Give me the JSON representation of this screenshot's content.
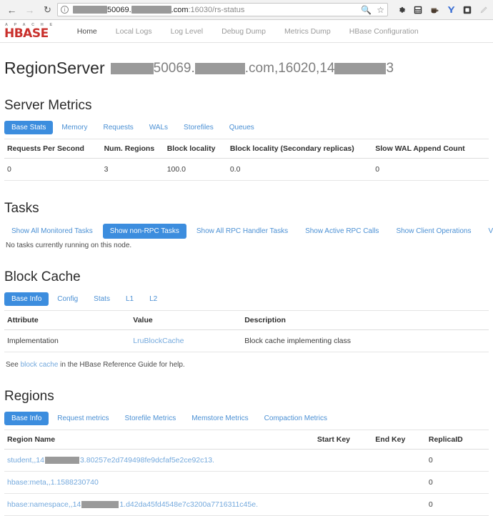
{
  "browser": {
    "back_icon": "back-arrow-icon",
    "forward_icon": "forward-arrow-icon",
    "reload_icon": "reload-icon",
    "info_icon": "info-icon",
    "url": {
      "redacted_1_width": 48,
      "visible_1": "50069.",
      "redacted_2_width": 56,
      "visible_2": ".com",
      "dim_suffix": ":16030/rs-status"
    },
    "search_icon": "search-icon",
    "star_icon": "bookmark-star-icon",
    "extensions": [
      "gear-icon",
      "calculator-icon",
      "coffee-icon",
      "y-letter-icon",
      "square-icon",
      "pen-icon"
    ]
  },
  "brand": {
    "apache": "A P A C H E",
    "hbase": "HBASE"
  },
  "nav": {
    "items": [
      {
        "label": "Home",
        "active": true
      },
      {
        "label": "Local Logs",
        "active": false
      },
      {
        "label": "Log Level",
        "active": false
      },
      {
        "label": "Debug Dump",
        "active": false
      },
      {
        "label": "Metrics Dump",
        "active": false
      },
      {
        "label": "HBase Configuration",
        "active": false
      }
    ]
  },
  "page_title": {
    "prefix": "RegionServer",
    "redacted_1_width": 60,
    "part_1": "50069.",
    "redacted_2_width": 70,
    "part_2": ".com,16020,14",
    "redacted_3_width": 72,
    "part_3": "3"
  },
  "server_metrics": {
    "heading": "Server Metrics",
    "tabs": [
      {
        "label": "Base Stats",
        "active": true
      },
      {
        "label": "Memory",
        "active": false
      },
      {
        "label": "Requests",
        "active": false
      },
      {
        "label": "WALs",
        "active": false
      },
      {
        "label": "Storefiles",
        "active": false
      },
      {
        "label": "Queues",
        "active": false
      }
    ],
    "columns": [
      "Requests Per Second",
      "Num. Regions",
      "Block locality",
      "Block locality (Secondary replicas)",
      "Slow WAL Append Count"
    ],
    "row": [
      "0",
      "3",
      "100.0",
      "0.0",
      "0"
    ]
  },
  "tasks": {
    "heading": "Tasks",
    "buttons": [
      {
        "label": "Show All Monitored Tasks",
        "active": false
      },
      {
        "label": "Show non-RPC Tasks",
        "active": true
      },
      {
        "label": "Show All RPC Handler Tasks",
        "active": false
      },
      {
        "label": "Show Active RPC Calls",
        "active": false
      },
      {
        "label": "Show Client Operations",
        "active": false
      },
      {
        "label": "View as JSON",
        "active": false
      }
    ],
    "empty_message": "No tasks currently running on this node."
  },
  "block_cache": {
    "heading": "Block Cache",
    "tabs": [
      {
        "label": "Base Info",
        "active": true
      },
      {
        "label": "Config",
        "active": false
      },
      {
        "label": "Stats",
        "active": false
      },
      {
        "label": "L1",
        "active": false
      },
      {
        "label": "L2",
        "active": false
      }
    ],
    "columns": [
      "Attribute",
      "Value",
      "Description"
    ],
    "rows": [
      {
        "attribute": "Implementation",
        "value": "LruBlockCache",
        "description": "Block cache implementing class"
      }
    ],
    "help_prefix": "See ",
    "help_link": "block cache",
    "help_suffix": " in the HBase Reference Guide for help."
  },
  "regions": {
    "heading": "Regions",
    "tabs": [
      {
        "label": "Base Info",
        "active": true
      },
      {
        "label": "Request metrics",
        "active": false
      },
      {
        "label": "Storefile Metrics",
        "active": false
      },
      {
        "label": "Memstore Metrics",
        "active": false
      },
      {
        "label": "Compaction Metrics",
        "active": false
      }
    ],
    "columns": [
      "Region Name",
      "Start Key",
      "End Key",
      "ReplicaID"
    ],
    "rows": [
      {
        "name_prefix": "student,,14",
        "redact_width": 48,
        "name_suffix": "3.80257e2d749498fe9dcfaf5e2ce92c13.",
        "start_key": "",
        "end_key": "",
        "replica_id": "0"
      },
      {
        "name_prefix": "hbase:meta,,1.1588230740",
        "redact_width": 0,
        "name_suffix": "",
        "start_key": "",
        "end_key": "",
        "replica_id": "0"
      },
      {
        "name_prefix": "hbase:namespace,,14",
        "redact_width": 52,
        "name_suffix": "1.d42da45fd4548e7c3200a7716311c45e.",
        "start_key": "",
        "end_key": "",
        "replica_id": "0"
      }
    ]
  },
  "colors": {
    "accent_blue": "#3c8dde",
    "link_blue": "#4b90d4",
    "brand_red": "#c9302c",
    "redaction_gray": "#9a9a9a"
  }
}
